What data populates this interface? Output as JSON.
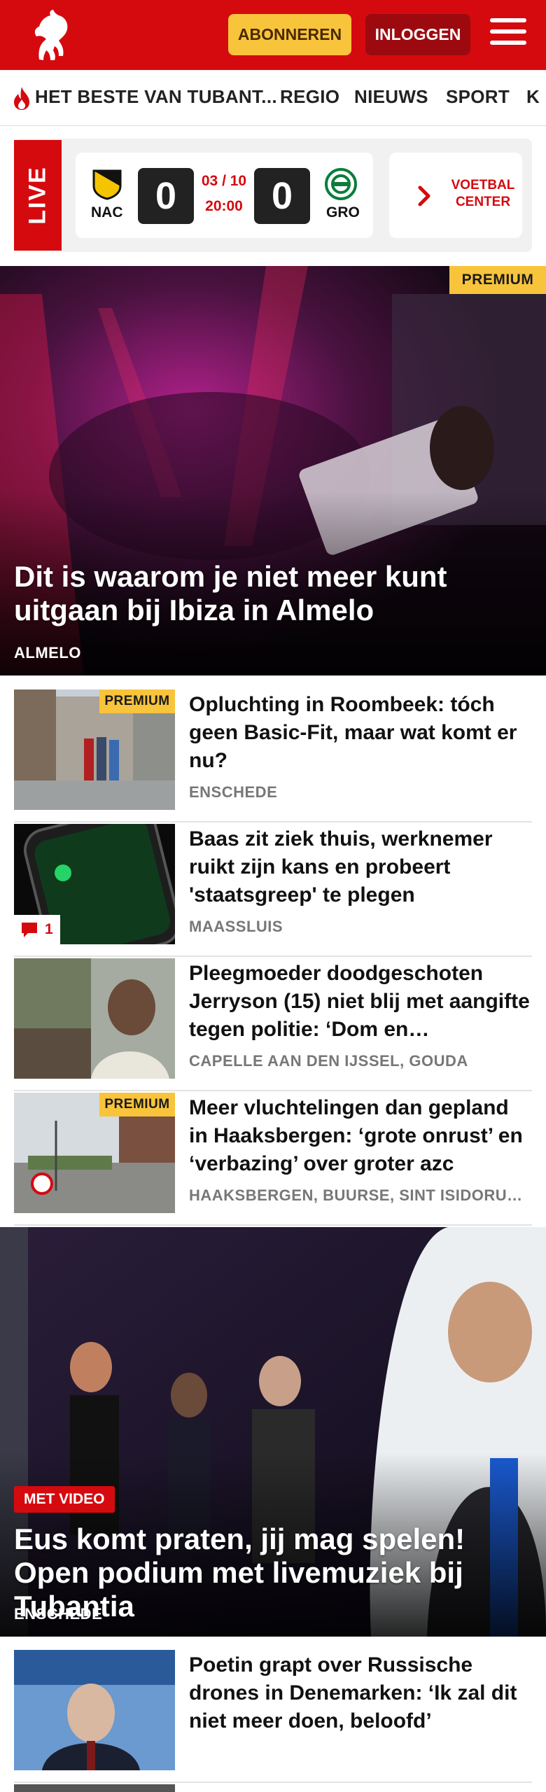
{
  "header": {
    "subscribe_label": "ABONNEREN",
    "login_label": "INLOGGEN",
    "brand_color": "#d50a0f",
    "accent_color": "#f8c43b"
  },
  "nav": {
    "items": [
      "HET BESTE VAN TUBANT...",
      "REGIO",
      "NIEUWS",
      "SPORT",
      "K"
    ]
  },
  "live": {
    "label": "LIVE",
    "match": {
      "home": "NAC",
      "away": "GRO",
      "home_score": "0",
      "away_score": "0",
      "date": "03 / 10",
      "time": "20:00"
    },
    "more_label_line1": "VOETBAL",
    "more_label_line2": "CENTER"
  },
  "hero1": {
    "badge": "PREMIUM",
    "title": "Dit is waarom je niet meer kunt uitgaan bij Ibiza in Almelo",
    "tag": "ALMELO"
  },
  "articles": [
    {
      "title": "Opluchting in Roombeek: tóch geen Basic-Fit, maar wat komt er nu?",
      "tag": "ENSCHEDE",
      "badge": "PREMIUM"
    },
    {
      "title": "Baas zit ziek thuis, werknemer ruikt zijn kans en probeert 'staatsgreep' te plegen",
      "tag": "MAASSLUIS",
      "comments": "1"
    },
    {
      "title": "Pleegmoeder doodgeschoten Jerryson (15) niet blij met aangifte tegen politie: ‘Dom en onbegrijpelijk’",
      "tag": "CAPELLE AAN DEN IJSSEL, GOUDA"
    },
    {
      "title": "Meer vluchtelingen dan gepland in Haaksbergen: ‘grote onrust’ en ‘verbazing’ over groter azc",
      "tag": "HAAKSBERGEN, BUURSE, SINT ISIDORUSHOEVE",
      "badge": "PREMIUM"
    }
  ],
  "hero2": {
    "badge": "MET VIDEO",
    "title": "Eus komt praten, jij mag spelen! Open podium met livemuziek bij Tubantia",
    "tag": "ENSCHEDE"
  },
  "articles2": [
    {
      "title": "Poetin grapt over Russische drones in Denemarken: ‘Ik zal dit niet meer doen, beloofd’",
      "tag": ""
    }
  ]
}
